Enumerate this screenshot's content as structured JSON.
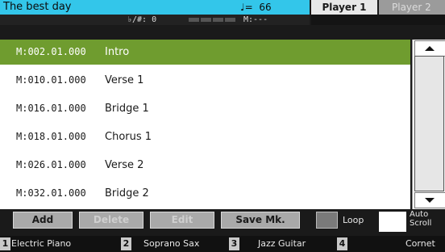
{
  "header": {
    "song_title": "The best day",
    "tempo": "♩=  66",
    "transpose": "♭/#: 0",
    "measure": "M:---"
  },
  "player_tabs": [
    {
      "label": "Player 1",
      "active": true
    },
    {
      "label": "Player 2",
      "active": false
    }
  ],
  "markers": [
    {
      "position": "M:002.01.000",
      "name": "Intro",
      "selected": true
    },
    {
      "position": "M:010.01.000",
      "name": "Verse 1",
      "selected": false
    },
    {
      "position": "M:016.01.000",
      "name": "Bridge 1",
      "selected": false
    },
    {
      "position": "M:018.01.000",
      "name": "Chorus 1",
      "selected": false
    },
    {
      "position": "M:026.01.000",
      "name": "Verse 2",
      "selected": false
    },
    {
      "position": "M:032.01.000",
      "name": "Bridge 2",
      "selected": false
    }
  ],
  "toolbar": {
    "add_label": "Add",
    "delete_label": "Delete",
    "edit_label": "Edit",
    "save_label": "Save Mk.",
    "loop_label": "Loop",
    "autoscroll_label": "Auto Scroll"
  },
  "tracks": [
    {
      "number": "1",
      "name": "Electric Piano"
    },
    {
      "number": "2",
      "name": "Soprano Sax"
    },
    {
      "number": "3",
      "name": "Jazz Guitar"
    },
    {
      "number": "4",
      "name": "Cornet"
    }
  ],
  "colors": {
    "title_bar": "#33c6ea",
    "selected_row": "#6f9c2f",
    "active_tab": "#e8e8e8",
    "inactive_tab": "#9b9b9b"
  },
  "icons": {
    "scroll_up": "triangle-up-icon",
    "scroll_down": "triangle-down-icon"
  }
}
